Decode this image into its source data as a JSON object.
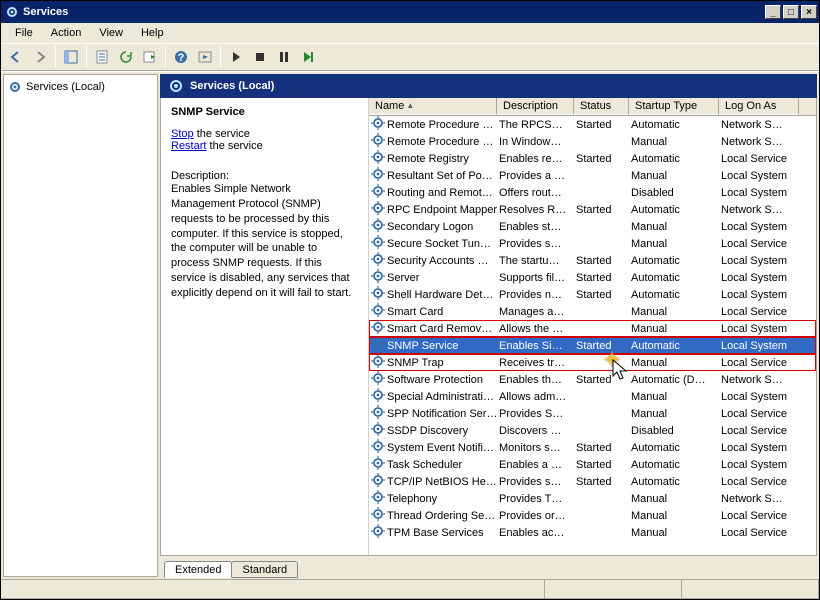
{
  "window": {
    "title": "Services"
  },
  "menu": {
    "file": "File",
    "action": "Action",
    "view": "View",
    "help": "Help"
  },
  "tree": {
    "root": "Services (Local)"
  },
  "header": {
    "title": "Services (Local)"
  },
  "detail": {
    "service_name": "SNMP Service",
    "stop_label": "Stop",
    "stop_suffix": " the service",
    "restart_label": "Restart",
    "restart_suffix": " the service",
    "desc_label": "Description:",
    "desc_text": "Enables Simple Network Management Protocol (SNMP) requests to be processed by this computer. If this service is stopped, the computer will be unable to process SNMP requests. If this service is disabled, any services that explicitly depend on it will fail to start."
  },
  "columns": {
    "name": "Name",
    "description": "Description",
    "status": "Status",
    "startup": "Startup Type",
    "logon": "Log On As"
  },
  "tabs": {
    "extended": "Extended",
    "standard": "Standard"
  },
  "services": [
    {
      "name": "Remote Procedure …",
      "desc": "The RPCSS…",
      "status": "Started",
      "startup": "Automatic",
      "logon": "Network S…"
    },
    {
      "name": "Remote Procedure …",
      "desc": "In Window…",
      "status": "",
      "startup": "Manual",
      "logon": "Network S…"
    },
    {
      "name": "Remote Registry",
      "desc": "Enables re…",
      "status": "Started",
      "startup": "Automatic",
      "logon": "Local Service"
    },
    {
      "name": "Resultant Set of Po…",
      "desc": "Provides a …",
      "status": "",
      "startup": "Manual",
      "logon": "Local System"
    },
    {
      "name": "Routing and Remot…",
      "desc": "Offers rout…",
      "status": "",
      "startup": "Disabled",
      "logon": "Local System"
    },
    {
      "name": "RPC Endpoint Mapper",
      "desc": "Resolves R…",
      "status": "Started",
      "startup": "Automatic",
      "logon": "Network S…"
    },
    {
      "name": "Secondary Logon",
      "desc": "Enables st…",
      "status": "",
      "startup": "Manual",
      "logon": "Local System"
    },
    {
      "name": "Secure Socket Tun…",
      "desc": "Provides s…",
      "status": "",
      "startup": "Manual",
      "logon": "Local Service"
    },
    {
      "name": "Security Accounts …",
      "desc": "The startu…",
      "status": "Started",
      "startup": "Automatic",
      "logon": "Local System"
    },
    {
      "name": "Server",
      "desc": "Supports fil…",
      "status": "Started",
      "startup": "Automatic",
      "logon": "Local System"
    },
    {
      "name": "Shell Hardware Det…",
      "desc": "Provides n…",
      "status": "Started",
      "startup": "Automatic",
      "logon": "Local System"
    },
    {
      "name": "Smart Card",
      "desc": "Manages a…",
      "status": "",
      "startup": "Manual",
      "logon": "Local Service"
    },
    {
      "name": "Smart Card Remov…",
      "desc": "Allows the …",
      "status": "",
      "startup": "Manual",
      "logon": "Local System",
      "highlight": true
    },
    {
      "name": "SNMP Service",
      "desc": "Enables Si…",
      "status": "Started",
      "startup": "Automatic",
      "logon": "Local System",
      "selected": true,
      "highlight": true
    },
    {
      "name": "SNMP Trap",
      "desc": "Receives tr…",
      "status": "",
      "startup": "Manual",
      "logon": "Local Service",
      "highlight": true
    },
    {
      "name": "Software Protection",
      "desc": "Enables th…",
      "status": "Started",
      "startup": "Automatic (D…",
      "logon": "Network S…"
    },
    {
      "name": "Special Administrati…",
      "desc": "Allows adm…",
      "status": "",
      "startup": "Manual",
      "logon": "Local System"
    },
    {
      "name": "SPP Notification Ser…",
      "desc": "Provides S…",
      "status": "",
      "startup": "Manual",
      "logon": "Local Service"
    },
    {
      "name": "SSDP Discovery",
      "desc": "Discovers …",
      "status": "",
      "startup": "Disabled",
      "logon": "Local Service"
    },
    {
      "name": "System Event Notifi…",
      "desc": "Monitors s…",
      "status": "Started",
      "startup": "Automatic",
      "logon": "Local System"
    },
    {
      "name": "Task Scheduler",
      "desc": "Enables a …",
      "status": "Started",
      "startup": "Automatic",
      "logon": "Local System"
    },
    {
      "name": "TCP/IP NetBIOS He…",
      "desc": "Provides s…",
      "status": "Started",
      "startup": "Automatic",
      "logon": "Local Service"
    },
    {
      "name": "Telephony",
      "desc": "Provides T…",
      "status": "",
      "startup": "Manual",
      "logon": "Network S…"
    },
    {
      "name": "Thread Ordering Se…",
      "desc": "Provides or…",
      "status": "",
      "startup": "Manual",
      "logon": "Local Service"
    },
    {
      "name": "TPM Base Services",
      "desc": "Enables ac…",
      "status": "",
      "startup": "Manual",
      "logon": "Local Service"
    }
  ]
}
